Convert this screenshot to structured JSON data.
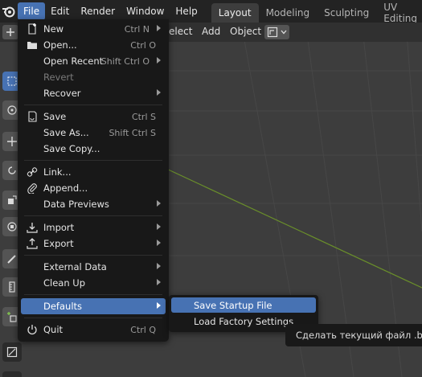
{
  "menubar": {
    "items": [
      "File",
      "Edit",
      "Render",
      "Window",
      "Help"
    ],
    "active_item": "File"
  },
  "workspaces": {
    "tabs": [
      "Layout",
      "Modeling",
      "Sculpting",
      "UV Editing"
    ],
    "active_tab": "Layout"
  },
  "header": {
    "select_label": "elect",
    "add_label": "Add",
    "object_label": "Object"
  },
  "file_menu": {
    "items": [
      {
        "label": "New",
        "shortcut": "Ctrl N",
        "icon": "new-file-icon",
        "submenu": true
      },
      {
        "label": "Open...",
        "shortcut": "Ctrl O",
        "icon": "folder-icon"
      },
      {
        "label": "Open Recent",
        "shortcut": "Shift Ctrl O",
        "submenu": true
      },
      {
        "label": "Revert",
        "disabled": true
      },
      {
        "label": "Recover",
        "submenu": true
      },
      {
        "label": "Save",
        "shortcut": "Ctrl S",
        "icon": "save-icon"
      },
      {
        "label": "Save As...",
        "shortcut": "Shift Ctrl S"
      },
      {
        "label": "Save Copy..."
      },
      {
        "label": "Link...",
        "icon": "link-icon"
      },
      {
        "label": "Append...",
        "icon": "append-icon"
      },
      {
        "label": "Data Previews",
        "submenu": true
      },
      {
        "label": "Import",
        "icon": "import-icon",
        "submenu": true
      },
      {
        "label": "Export",
        "icon": "export-icon",
        "submenu": true
      },
      {
        "label": "External Data",
        "submenu": true
      },
      {
        "label": "Clean Up",
        "submenu": true
      },
      {
        "label": "Defaults",
        "submenu": true,
        "highlighted": true
      },
      {
        "label": "Quit",
        "shortcut": "Ctrl Q",
        "icon": "power-icon"
      }
    ]
  },
  "defaults_submenu": {
    "items": [
      {
        "label": "Save Startup File",
        "highlighted": true
      },
      {
        "label": "Load Factory Settings"
      }
    ]
  },
  "tooltip": {
    "text": "Сделать текущий файл .blend"
  },
  "colors": {
    "accent": "#4772b3",
    "menu_bg": "#181818",
    "topbar_bg": "#232323",
    "viewport_bg": "#3d3d3d",
    "axis_green": "#6a8f2a"
  }
}
